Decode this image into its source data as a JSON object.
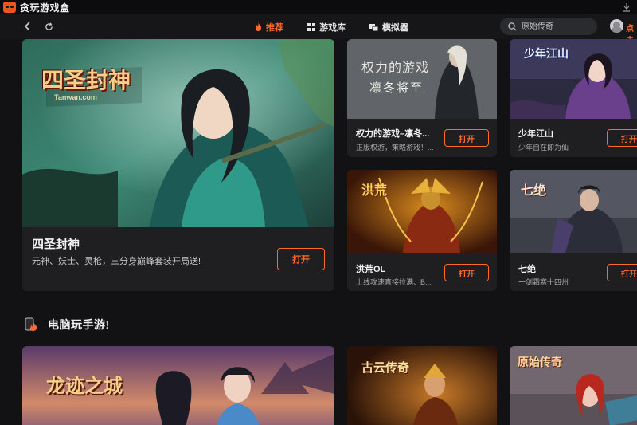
{
  "app": {
    "title": "贪玩游戏盒",
    "icon": "download-icon"
  },
  "nav": {
    "back_icon": "chevron-left-icon",
    "refresh_icon": "refresh-icon",
    "tabs": [
      {
        "label": "推荐",
        "icon": "fire-icon",
        "active": true
      },
      {
        "label": "游戏库",
        "icon": "grid-icon",
        "active": false
      },
      {
        "label": "模拟器",
        "icon": "gamepad-icon",
        "active": false
      }
    ],
    "search_placeholder": "原始传奇",
    "login_label": "点击"
  },
  "featured": {
    "art_title": "四圣封神",
    "art_sub": "Tanwan.com",
    "title": "四圣封神",
    "desc": "元神、妖士、灵枪，三分身巅峰套装开局送!",
    "button": "打开"
  },
  "games": [
    {
      "art_title": "权力的游戏",
      "art_sub": "凛冬将至",
      "title": "权力的游戏–凛冬...",
      "desc": "正版权游，策略游戏！...",
      "button": "打开"
    },
    {
      "art_title": "少年江山",
      "art_sub": "",
      "title": "少年江山",
      "desc": "少年自在即为仙",
      "button": "打开"
    },
    {
      "art_title": "洪荒",
      "art_sub": "",
      "title": "洪荒OL",
      "desc": "上线攻速直接拉满、B...",
      "button": "打开"
    },
    {
      "art_title": "七绝",
      "art_sub": "",
      "title": "七绝",
      "desc": "一剑霜寒十四州",
      "button": "打开"
    }
  ],
  "section": {
    "title": "电脑玩手游!",
    "icon": "phone-fire-icon"
  },
  "bottom_cards": [
    {
      "art_title": "龙迹之城"
    },
    {
      "art_title": "古云传奇"
    },
    {
      "art_title": "原始传奇"
    }
  ],
  "colors": {
    "accent": "#ff6a2b",
    "bg": "#121214",
    "card": "#1f1f22"
  }
}
